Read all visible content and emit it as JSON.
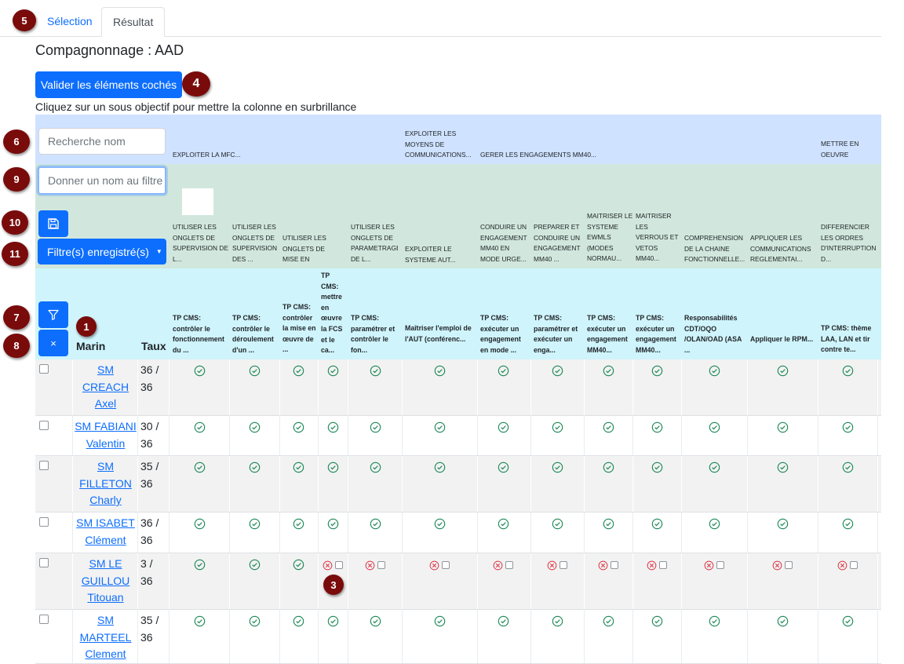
{
  "tabs": [
    {
      "label": "Sélection"
    },
    {
      "label": "Résultat"
    }
  ],
  "page_title": "Compagnonnage : AAD",
  "validate_button": "Valider les éléments cochés",
  "hint": "Cliquez sur un sous objectif pour mettre la colonne en surbrillance",
  "search_placeholder": "Recherche nom",
  "filter_name_placeholder": "Donner un nom au filtre",
  "saved_filters_label": "Filtre(s) enregistré(s)",
  "col_marin": "Marin",
  "col_taux": "Taux",
  "badges": {
    "b1": "1",
    "b3": "3",
    "b4": "4",
    "b5": "5",
    "b6": "6",
    "b7": "7",
    "b8": "8",
    "b9": "9",
    "b10": "10",
    "b11": "11"
  },
  "objectives": [
    "EXPLOITER LA MFC...",
    "EXPLOITER LES MOYENS DE COMMUNICATIONS...",
    "GERER LES ENGAGEMENTS MM40...",
    "METTRE EN OEUVRE L'ARMEMENT AUDE..."
  ],
  "sub_objectives": [
    "UTILISER LES ONGLETS DE SUPERVISION DE L...",
    "UTILISER LES ONGLETS DE SUPERVISION DES ...",
    "UTILISER LES ONGLETS DE MISE EN OEUVRE D...",
    "UTILISER LES ONGLETS DE PARAMETRAGE DE L...",
    "EXPLOITER LE SYSTEME AUT...",
    "CONDUIRE UN ENGAGEMENT MM40 EN MODE URGE...",
    "PREPARER ET CONDUIRE UN ENGAGEMENT MM40 ...",
    "MAITRISER LE SYSTEME EWMLS (MODES NORMAU...",
    "MAITRISER LES VERROUS ET VETOS MM40...",
    "COMPREHENSION DE LA CHAINE FONCTIONNELLE...",
    "APPLIQUER LES COMMUNICATIONS REGLEMENTAI...",
    "DIFFERENCIER LES ORDRES D'INTERRUPTION D..."
  ],
  "tasks": [
    "TP CMS: contrôler le fonctionnement du ...",
    "TP CMS: contrôler le déroulement d'un ...",
    "TP CMS: contrôler la mise en œuvre de ...",
    "TP CMS: mettre en œuvre la FCS et le ca...",
    "TP CMS: paramétrer et contrôler le fon...",
    "Maîtriser l'emploi de l'AUT (conférenc...",
    "TP CMS: exécuter un engagement en mode ...",
    "TP CMS: paramétrer et exécuter un enga...",
    "TP CMS: exécuter un engagement MM40...",
    "TP CMS: exécuter un engagement MM40...",
    "Responsabilités CDT/OQO /OLAN/OAD (ASA ...",
    "Appliquer le RPM...",
    "TP CMS: thème LAA, LAN et tir contre te..."
  ],
  "rows": [
    {
      "name": [
        "SM",
        "CREACH",
        "Axel"
      ],
      "taux": [
        "36 /",
        "36"
      ],
      "status": "ok"
    },
    {
      "name": [
        "SM FABIANI",
        "Valentin"
      ],
      "taux": [
        "30 /",
        "36"
      ],
      "status": "ok"
    },
    {
      "name": [
        "SM",
        "FILLETON",
        "Charly"
      ],
      "taux": [
        "35 /",
        "36"
      ],
      "status": "ok"
    },
    {
      "name": [
        "SM ISABET",
        "Clément"
      ],
      "taux": [
        "36 /",
        "36"
      ],
      "status": "ok"
    },
    {
      "name": [
        "SM LE",
        "GUILLOU",
        "Titouan"
      ],
      "taux": [
        "3 /",
        "36"
      ],
      "status": "ko"
    },
    {
      "name": [
        "SM",
        "MARTEEL",
        "Clement"
      ],
      "taux": [
        "35 /",
        "36"
      ],
      "status": "ok"
    }
  ],
  "colors": {
    "primary": "#0d6efd",
    "ok": "#198754",
    "ko": "#dc3545",
    "badge": "#7a0b0b",
    "band1": "#cfe2ff",
    "band2": "#d1e7dd",
    "band3": "#cff4fc"
  },
  "icons": [
    "save-icon",
    "filter-icon",
    "close-icon",
    "caret-down-icon",
    "check-circle-icon",
    "x-circle-icon"
  ]
}
